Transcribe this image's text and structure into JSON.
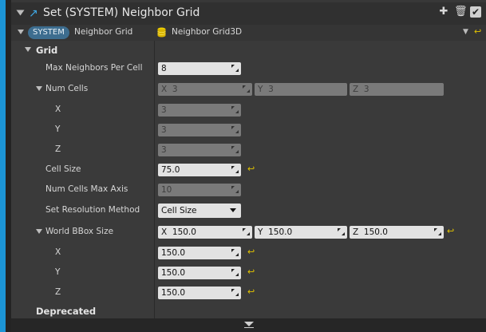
{
  "header": {
    "title": "Set (SYSTEM) Neighbor Grid",
    "icon": "arrow-up-right-icon",
    "buttons": [
      "+",
      "trash",
      "check"
    ]
  },
  "system_row": {
    "badge": "SYSTEM",
    "name": "Neighbor Grid",
    "value": "Neighbor Grid3D",
    "value_icon": "database-icon"
  },
  "grid": {
    "category": "Grid",
    "max_neighbors_label": "Max Neighbors Per Cell",
    "max_neighbors_value": "8",
    "num_cells_label": "Num Cells",
    "num_cells": {
      "x_prefix": "X",
      "x_value": "3",
      "y_prefix": "Y",
      "y_value": "3",
      "z_prefix": "Z",
      "z_value": "3"
    },
    "x_label": "X",
    "x_value": "3",
    "y_label": "Y",
    "y_value": "3",
    "z_label": "Z",
    "z_value": "3",
    "cell_size_label": "Cell Size",
    "cell_size_value": "75.0",
    "num_cells_max_axis_label": "Num Cells Max Axis",
    "num_cells_max_axis_value": "10",
    "set_resolution_label": "Set Resolution Method",
    "set_resolution_value": "Cell Size",
    "world_bbox_label": "World BBox Size",
    "world_bbox": {
      "x_prefix": "X",
      "x_value": "150.0",
      "y_prefix": "Y",
      "y_value": "150.0",
      "z_prefix": "Z",
      "z_value": "150.0"
    },
    "bbox_x_label": "X",
    "bbox_x_value": "150.0",
    "bbox_y_label": "Y",
    "bbox_y_value": "150.0",
    "bbox_z_label": "Z",
    "bbox_z_value": "150.0"
  },
  "deprecated_label": "Deprecated",
  "colors": {
    "accent": "#1c95d6",
    "reset_arrow": "#e0c200",
    "badge": "#3d6d8f"
  }
}
